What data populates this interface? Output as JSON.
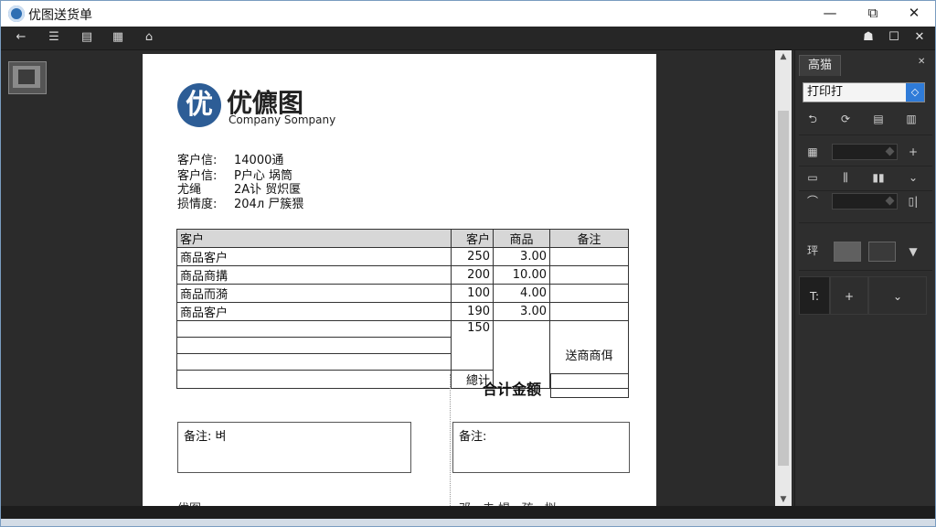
{
  "window": {
    "title": "优图送货单",
    "minimize_glyph": "—",
    "maximize_glyph": "⧉",
    "close_glyph": "✕"
  },
  "toolbar": {
    "left_icons": [
      "back-arrow-icon",
      "list-icon",
      "print-icon",
      "grid-icon",
      "tag-icon"
    ],
    "left_glyphs": [
      "←",
      "☰",
      "▤",
      "▦",
      "⌂"
    ],
    "right_icons": [
      "users-icon",
      "restore-icon",
      "close-icon"
    ],
    "right_glyphs": [
      "☗",
      "☐",
      "✕"
    ]
  },
  "document": {
    "logo_char": "优",
    "company_name": "优儦图",
    "company_sub": "Company Sompany",
    "info": [
      {
        "label": "客户信:",
        "value": "14000通"
      },
      {
        "label": "客户信:",
        "value": "P户心 埚筒"
      },
      {
        "label": "尤绳",
        "value": "2A讣 贸炽匽"
      },
      {
        "label": "损情度:",
        "value": "204л 尸簇猥"
      }
    ],
    "table": {
      "headers": [
        "客户",
        "客户",
        "商品",
        "备注"
      ],
      "rows": [
        {
          "name": "商品客户",
          "qty": "250",
          "price": "3.00"
        },
        {
          "name": "商品商搆",
          "qty": "200",
          "price": "10.00"
        },
        {
          "name": "商品而漪",
          "qty": "100",
          "price": "4.00"
        },
        {
          "name": "商品客户",
          "qty": "190",
          "price": "3.00"
        }
      ],
      "extra_qty": "150",
      "extra_note": "送商商佴",
      "subtotal_label": "總计"
    },
    "total_label": "合计金额",
    "note_left": "备注: 벼",
    "note_right": "备注:",
    "footer_left": "优图 · ·",
    "footer_right": "邓一夫·媞 ·   孩 · 拟"
  },
  "panel": {
    "tab": "高猫",
    "close": "✕",
    "select_value": "打印打",
    "row1_icons": [
      "undo-icon",
      "refresh-icon",
      "layout-icon",
      "page-icon"
    ],
    "row1_glyphs": [
      "⮌",
      "⟳",
      "▤",
      "▥"
    ],
    "row2": {
      "icon": "grid-icon",
      "glyph": "▦",
      "add": "+"
    },
    "row3_icons": [
      "rect-icon",
      "columns-icon",
      "bars-icon",
      "chevron-down-icon"
    ],
    "row3_glyphs": [
      "▭",
      "⫼",
      "▮▮",
      "⌄"
    ],
    "row4": {
      "icon": "arc-icon",
      "glyph": "⌒",
      "end": "▯|"
    },
    "row5": {
      "label": "玶",
      "arrow": "▼"
    },
    "row6": {
      "left": "T:",
      "mid": "+",
      "right": "⌄"
    },
    "swatch1": "#606060",
    "swatch2": "#3a3a3a"
  }
}
